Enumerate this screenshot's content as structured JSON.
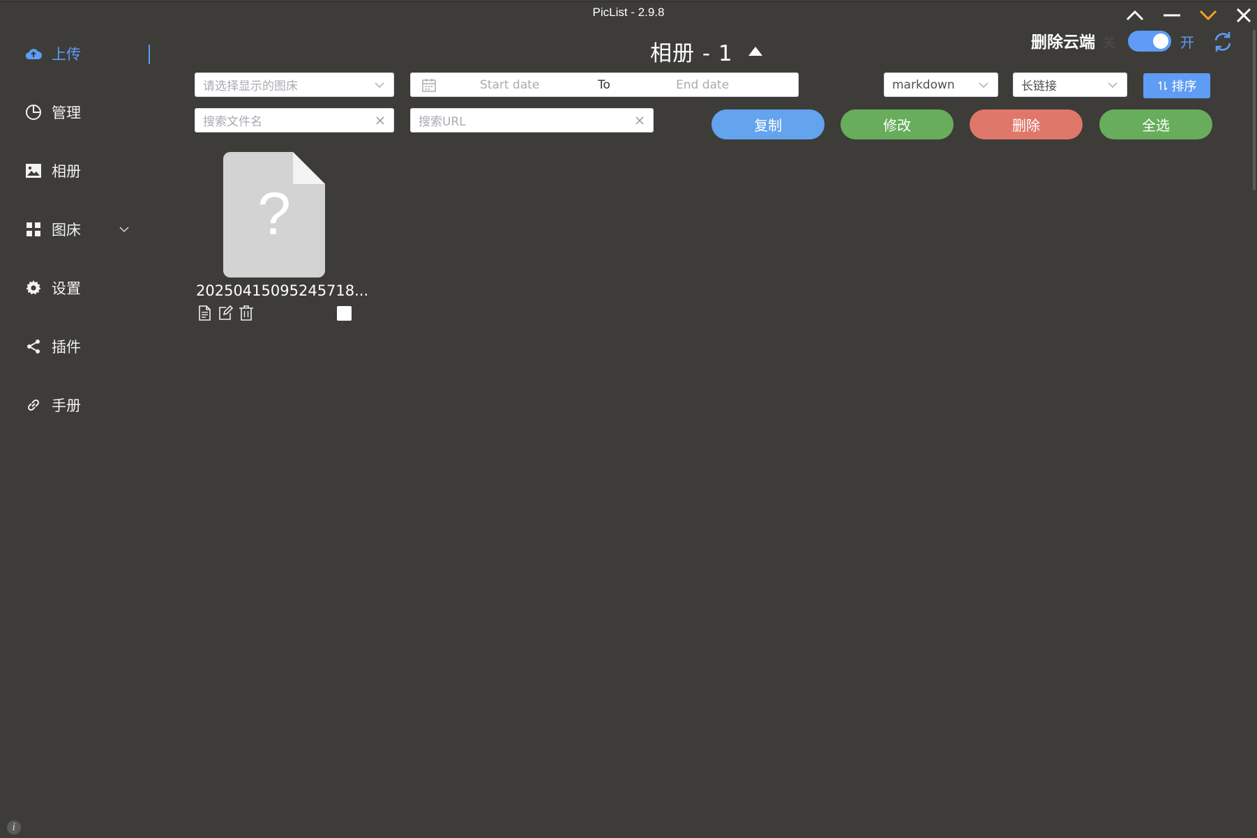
{
  "window": {
    "title": "PicList - 2.9.8"
  },
  "sidebar": {
    "items": [
      {
        "label": "上传",
        "icon": "cloud-upload-icon",
        "active": true
      },
      {
        "label": "管理",
        "icon": "pie-chart-icon"
      },
      {
        "label": "相册",
        "icon": "image-icon"
      },
      {
        "label": "图床",
        "icon": "grid-icon",
        "expandable": true
      },
      {
        "label": "设置",
        "icon": "gear-icon"
      },
      {
        "label": "插件",
        "icon": "share-icon"
      },
      {
        "label": "手册",
        "icon": "link-icon"
      }
    ]
  },
  "header": {
    "title": "相册 - 1",
    "delete_cloud_label": "删除云端",
    "switch_off_label": "关",
    "switch_on_label": "开",
    "switch_on": true
  },
  "filters": {
    "picbed_placeholder": "请选择显示的图床",
    "date_start_placeholder": "Start date",
    "date_separator": "To",
    "date_end_placeholder": "End date",
    "format_value": "markdown",
    "link_type_value": "长链接",
    "sort_label": "排序",
    "search_filename_placeholder": "搜索文件名",
    "search_url_placeholder": "搜索URL"
  },
  "actions": {
    "copy_label": "复制",
    "modify_label": "修改",
    "delete_label": "删除",
    "select_all_label": "全选"
  },
  "gallery": {
    "items": [
      {
        "name": "20250415095245718...",
        "thumb_glyph": "?"
      }
    ]
  },
  "colors": {
    "background": "#3d3c39",
    "accent": "#5e9cf5",
    "copy": "#64a3ed",
    "modify": "#67ad5b",
    "delete": "#e0776b",
    "select_all": "#67ad5b",
    "minimize_chevron": "#f5a623"
  }
}
